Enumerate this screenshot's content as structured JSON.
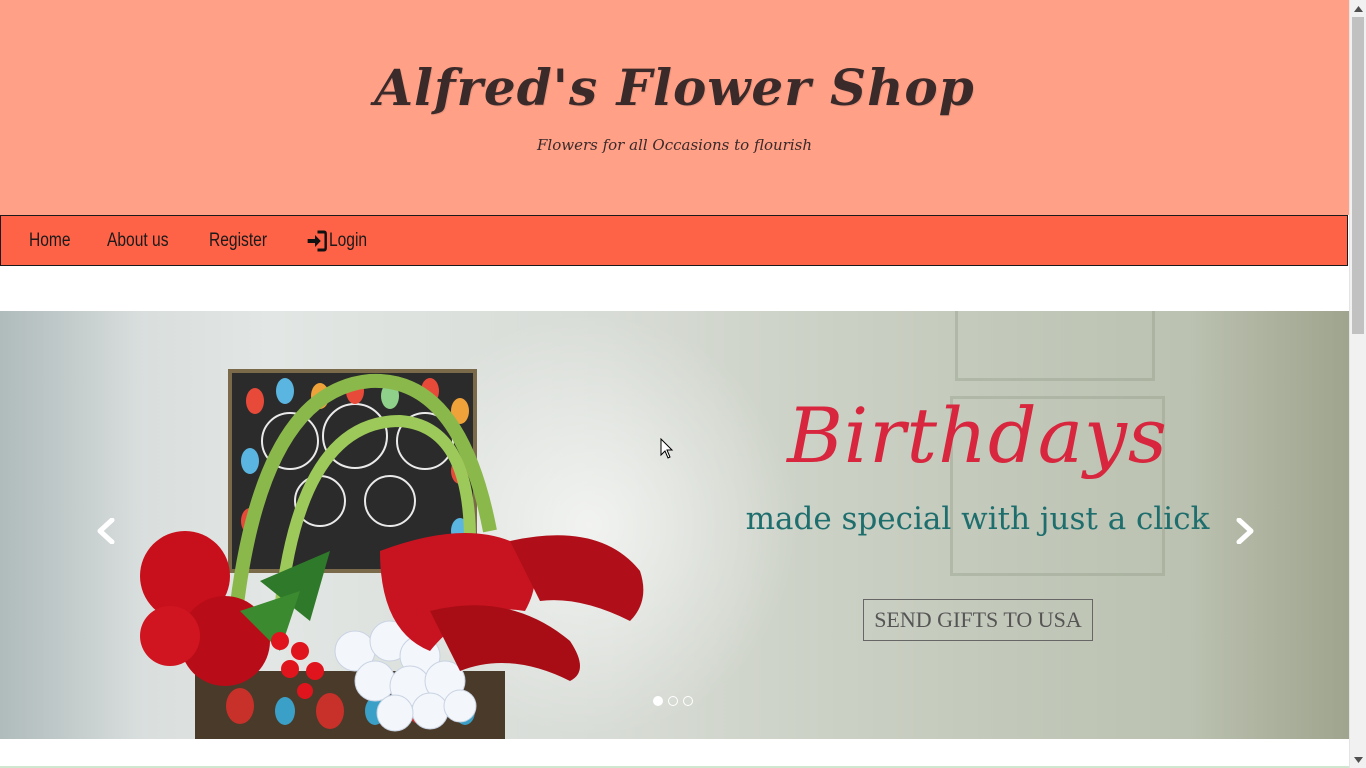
{
  "header": {
    "title": "Alfred's Flower Shop",
    "tagline": "Flowers for all Occasions to flourish"
  },
  "nav": {
    "home": "Home",
    "about": "About us",
    "register": "Register",
    "login": "Login"
  },
  "carousel": {
    "headline": "Birthdays",
    "subline": "made special with just a click",
    "cta": "SEND GIFTS TO USA",
    "active_slide": 1,
    "slide_count": 3
  },
  "colors": {
    "header_bg": "#ffa087",
    "nav_bg": "#ff6347",
    "headline": "#d7263d",
    "subline": "#1f6e6e"
  },
  "icons": {
    "login": "sign-in-icon",
    "prev": "chevron-left-icon",
    "next": "chevron-right-icon"
  }
}
